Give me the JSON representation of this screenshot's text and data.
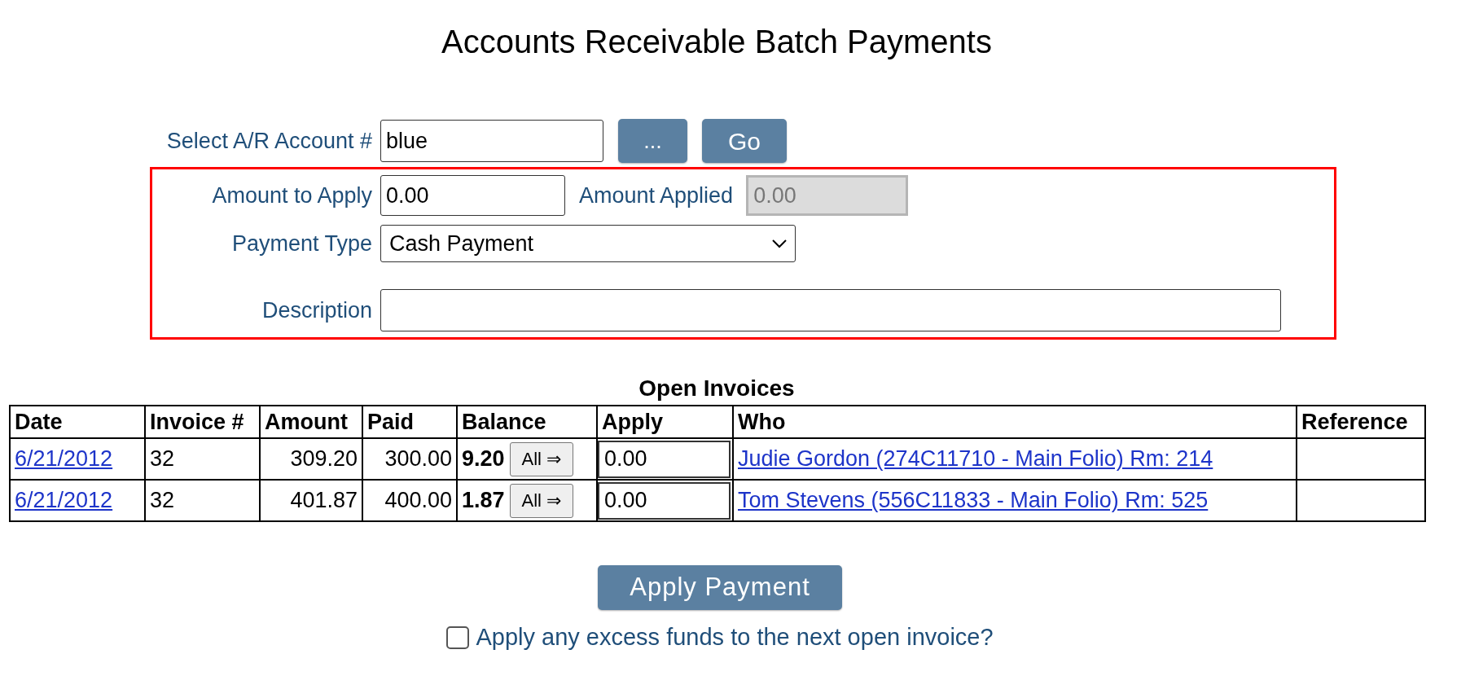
{
  "title": "Accounts Receivable Batch Payments",
  "account": {
    "label": "Select A/R Account #",
    "value": "blue",
    "lookup_button": "...",
    "go_button": "Go"
  },
  "payment": {
    "amount_to_apply": {
      "label": "Amount to Apply",
      "value": "0.00"
    },
    "amount_applied": {
      "label": "Amount Applied",
      "value": "0.00",
      "disabled": true
    },
    "payment_type": {
      "label": "Payment Type",
      "value": "Cash Payment"
    },
    "description": {
      "label": "Description"
    }
  },
  "invoices": {
    "title": "Open Invoices",
    "columns": [
      "Date",
      "Invoice #",
      "Amount",
      "Paid",
      "Balance",
      "Apply",
      "Who",
      "Reference"
    ],
    "rows": [
      {
        "date": "6/21/2012",
        "invoice": "32",
        "amount": "309.20",
        "paid": "300.00",
        "balance": "9.20",
        "all_button": "All ⇒",
        "apply": "0.00",
        "who": "Judie Gordon (274C11710 - Main Folio) Rm: 214"
      },
      {
        "date": "6/21/2012",
        "invoice": "32",
        "amount": "401.87",
        "paid": "400.00",
        "balance": "1.87",
        "all_button": "All ⇒",
        "apply": "0.00",
        "who": "Tom Stevens (556C11833 - Main Folio) Rm: 525"
      }
    ]
  },
  "apply_button": "Apply Payment",
  "excess_funds": {
    "label": "Apply any excess funds to the next open invoice?",
    "checked": false
  }
}
